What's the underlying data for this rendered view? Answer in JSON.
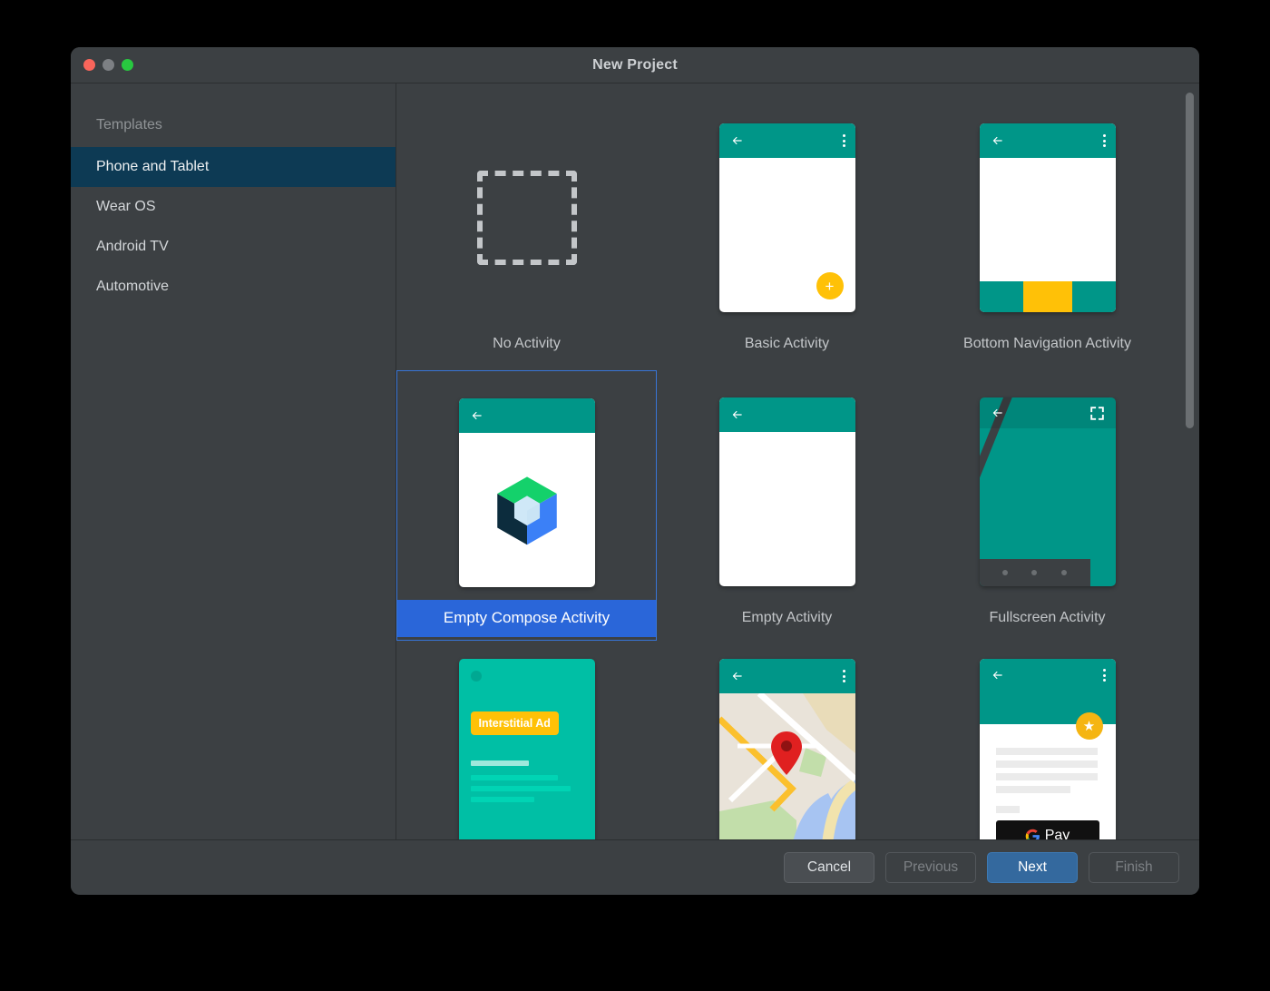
{
  "window": {
    "title": "New Project",
    "traffic_lights": [
      "close-button",
      "minimize-button",
      "maximize-button"
    ]
  },
  "sidebar": {
    "heading": "Templates",
    "items": [
      {
        "label": "Phone and Tablet",
        "selected": true
      },
      {
        "label": "Wear OS",
        "selected": false
      },
      {
        "label": "Android TV",
        "selected": false
      },
      {
        "label": "Automotive",
        "selected": false
      }
    ]
  },
  "templates": [
    {
      "label": "No Activity",
      "selected": false,
      "thumb": "dashed-placeholder"
    },
    {
      "label": "Basic Activity",
      "selected": false,
      "thumb": "appbar-fab"
    },
    {
      "label": "Bottom Navigation Activity",
      "selected": false,
      "thumb": "appbar-bottomnav"
    },
    {
      "label": "Empty Compose Activity",
      "selected": true,
      "thumb": "compose-logo"
    },
    {
      "label": "Empty Activity",
      "selected": false,
      "thumb": "appbar-blank"
    },
    {
      "label": "Fullscreen Activity",
      "selected": false,
      "thumb": "fullscreen"
    },
    {
      "label": "",
      "selected": false,
      "thumb": "interstitial-ad",
      "ad_badge": "Interstitial Ad"
    },
    {
      "label": "",
      "selected": false,
      "thumb": "google-maps"
    },
    {
      "label": "",
      "selected": false,
      "thumb": "google-pay",
      "pay_label": "Pay"
    }
  ],
  "footer": {
    "buttons": [
      {
        "label": "Cancel",
        "state": "enabled"
      },
      {
        "label": "Previous",
        "state": "disabled"
      },
      {
        "label": "Next",
        "state": "primary"
      },
      {
        "label": "Finish",
        "state": "disabled"
      }
    ]
  },
  "colors": {
    "window_bg": "#3c4043",
    "selection_blue": "#2a66d9",
    "sidebar_selection": "#0d3a54",
    "teal": "#009688",
    "amber": "#ffc107",
    "primary_button": "#34699e"
  }
}
